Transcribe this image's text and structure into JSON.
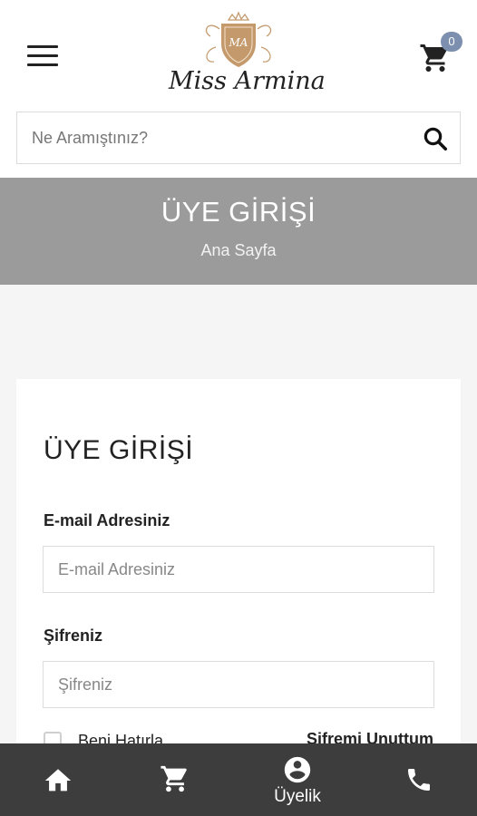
{
  "header": {
    "brand": "Miss Armina",
    "brand_monogram": "MA",
    "cart_count": "0"
  },
  "search": {
    "placeholder": "Ne Aramıştınız?"
  },
  "banner": {
    "title": "ÜYE GİRİŞİ",
    "breadcrumb": "Ana Sayfa"
  },
  "login": {
    "title": "ÜYE GİRİŞİ",
    "email_label": "E-mail Adresiniz",
    "email_placeholder": "E-mail Adresiniz",
    "password_label": "Şifreniz",
    "password_placeholder": "Şifreniz",
    "remember_label": "Beni Hatırla",
    "forgot_label": "Şifremi Unuttum"
  },
  "bottom_nav": {
    "items": [
      {
        "icon": "home-icon",
        "label": ""
      },
      {
        "icon": "cart-icon",
        "label": ""
      },
      {
        "icon": "account-icon",
        "label": "Üyelik"
      },
      {
        "icon": "phone-icon",
        "label": ""
      }
    ]
  },
  "colors": {
    "banner_bg": "#9b9b9b",
    "bottom_nav_bg": "#3d3d3d",
    "badge_bg": "#7c8fae",
    "logo_gold": "#c49a6c"
  }
}
